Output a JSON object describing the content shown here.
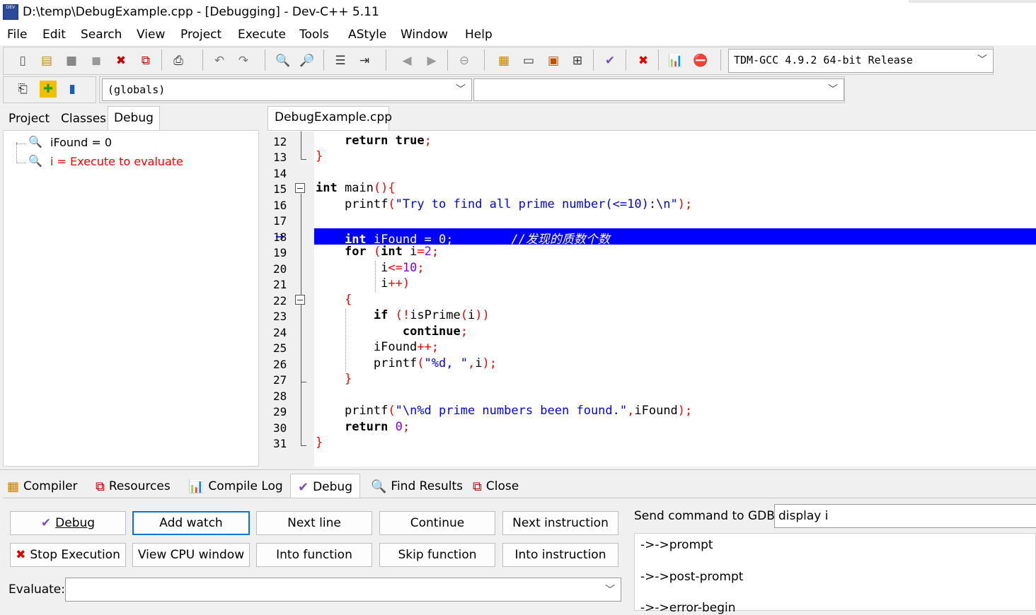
{
  "window": {
    "title": "D:\\temp\\DebugExample.cpp - [Debugging] - Dev-C++ 5.11",
    "app_icon_text": "DEV"
  },
  "menu": [
    "File",
    "Edit",
    "Search",
    "View",
    "Project",
    "Execute",
    "Tools",
    "AStyle",
    "Window",
    "Help"
  ],
  "toolbar": {
    "compiler_select": "TDM-GCC 4.9.2 64-bit Release",
    "scope_select": "(globals)",
    "function_select": ""
  },
  "left_panel": {
    "tabs": [
      "Project",
      "Classes",
      "Debug"
    ],
    "active_tab": "Debug",
    "watches": [
      {
        "text": "iFound = 0",
        "color": "#000000"
      },
      {
        "text": "i = Execute to evaluate",
        "color": "#ff0000"
      }
    ]
  },
  "editor": {
    "file_tab": "DebugExample.cpp",
    "current_line": 18,
    "highlight_color": "#0000ff",
    "lines": [
      {
        "n": "12",
        "code": "    return true;"
      },
      {
        "n": "13",
        "code": "}"
      },
      {
        "n": "14",
        "code": ""
      },
      {
        "n": "15",
        "code": "int main(){"
      },
      {
        "n": "16",
        "code": "    printf(\"Try to find all prime number(<=10):\\n\");"
      },
      {
        "n": "17",
        "code": ""
      },
      {
        "n": "18",
        "code": "    int iFound = 0;        //发现的质数个数"
      },
      {
        "n": "19",
        "code": "    for (int i=2;"
      },
      {
        "n": "20",
        "code": "         i<=10;"
      },
      {
        "n": "21",
        "code": "         i++)"
      },
      {
        "n": "22",
        "code": "    {"
      },
      {
        "n": "23",
        "code": "        if (!isPrime(i))"
      },
      {
        "n": "24",
        "code": "            continue;"
      },
      {
        "n": "25",
        "code": "        iFound++;"
      },
      {
        "n": "26",
        "code": "        printf(\"%d, \",i);"
      },
      {
        "n": "27",
        "code": "    }"
      },
      {
        "n": "28",
        "code": ""
      },
      {
        "n": "29",
        "code": "    printf(\"\\n%d prime numbers been found.\",iFound);"
      },
      {
        "n": "30",
        "code": "    return 0;"
      },
      {
        "n": "31",
        "code": "}"
      }
    ]
  },
  "bottom": {
    "tabs": [
      {
        "label": "Compiler",
        "icon": "grid-icon"
      },
      {
        "label": "Resources",
        "icon": "resources-icon"
      },
      {
        "label": "Compile Log",
        "icon": "chart-icon"
      },
      {
        "label": "Debug",
        "icon": "check-icon"
      },
      {
        "label": "Find Results",
        "icon": "find-icon"
      },
      {
        "label": "Close",
        "icon": "close-icon"
      }
    ],
    "active_tab": "Debug",
    "buttons_row1": [
      "Debug",
      "Add watch",
      "Next line",
      "Continue",
      "Next instruction"
    ],
    "buttons_row2": [
      "Stop Execution",
      "View CPU window",
      "Into function",
      "Skip function",
      "Into instruction"
    ],
    "gdb_label": "Send command to GDB:",
    "gdb_command": "display i",
    "gdb_output": [
      "->->prompt",
      "->->post-prompt",
      "->->error-begin"
    ],
    "evaluate_label": "Evaluate:",
    "evaluate_value": ""
  }
}
